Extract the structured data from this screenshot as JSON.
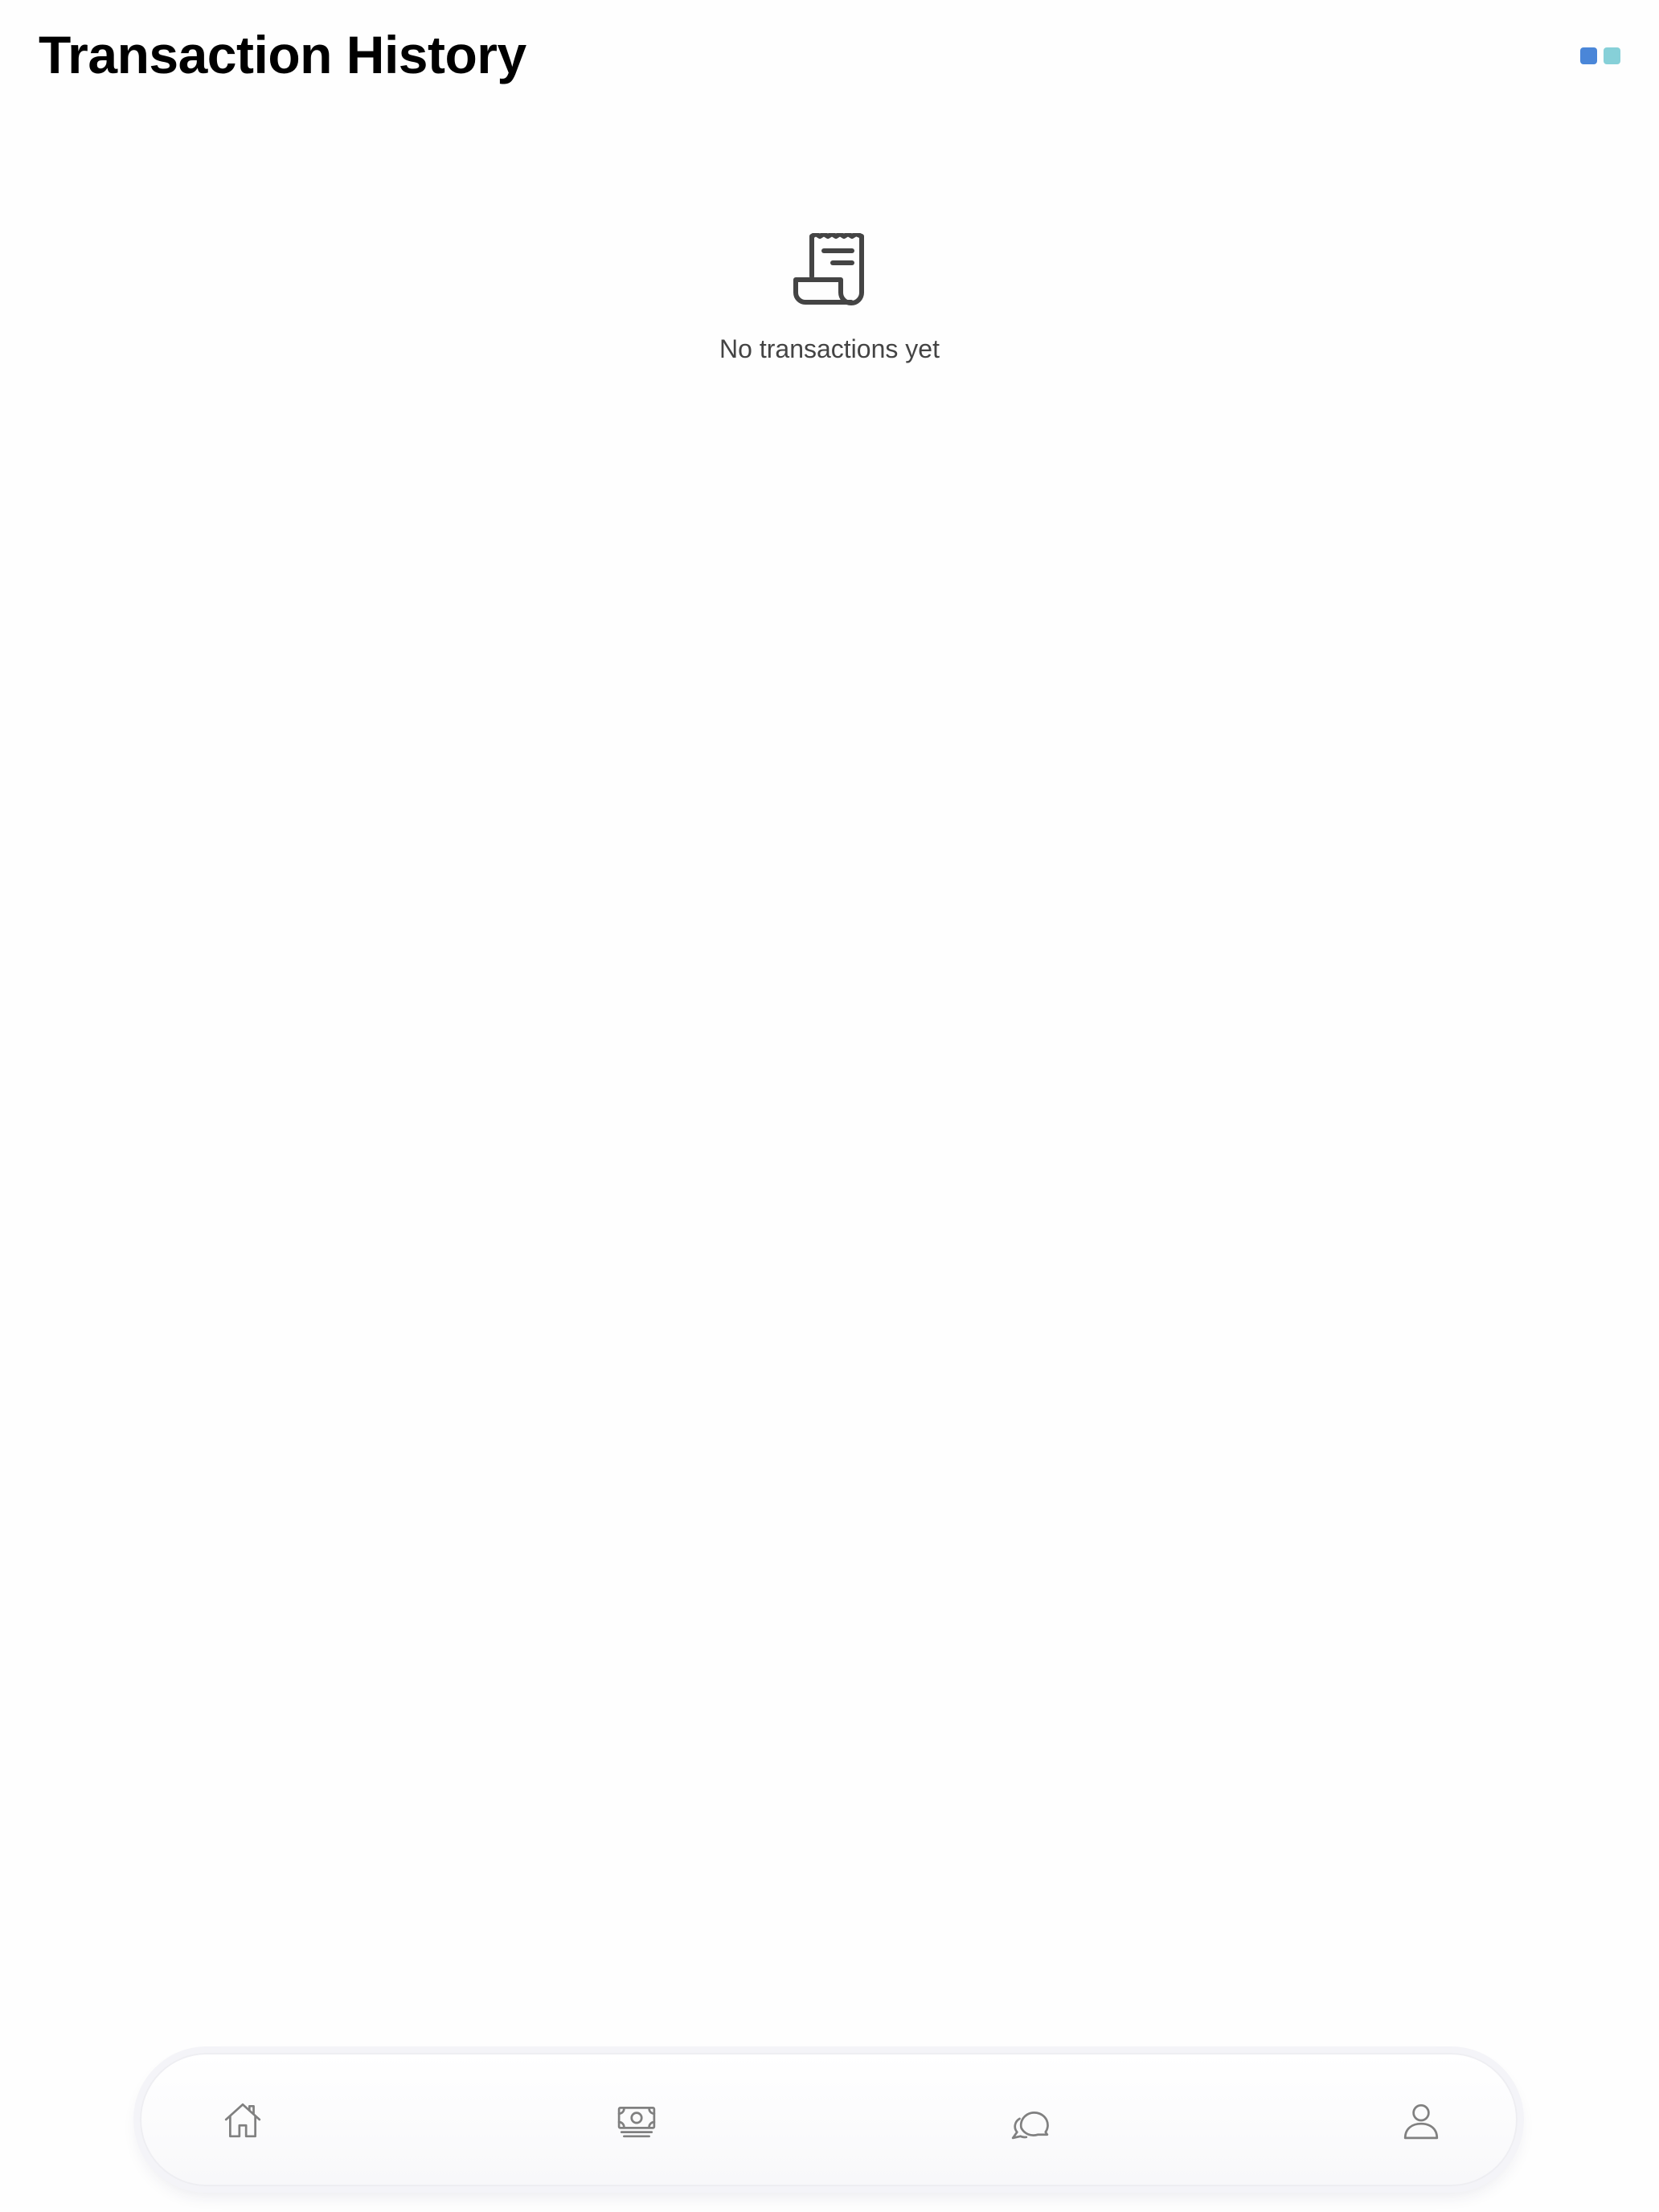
{
  "header": {
    "title": "Transaction History",
    "brand_colors": [
      "#4a86d8",
      "#86d0d8"
    ]
  },
  "empty_state": {
    "icon": "receipt-icon",
    "message": "No transactions yet"
  },
  "bottom_nav": {
    "items": [
      {
        "icon": "home-icon"
      },
      {
        "icon": "cash-icon"
      },
      {
        "icon": "chat-bubble-icon"
      },
      {
        "icon": "user-icon"
      }
    ]
  }
}
